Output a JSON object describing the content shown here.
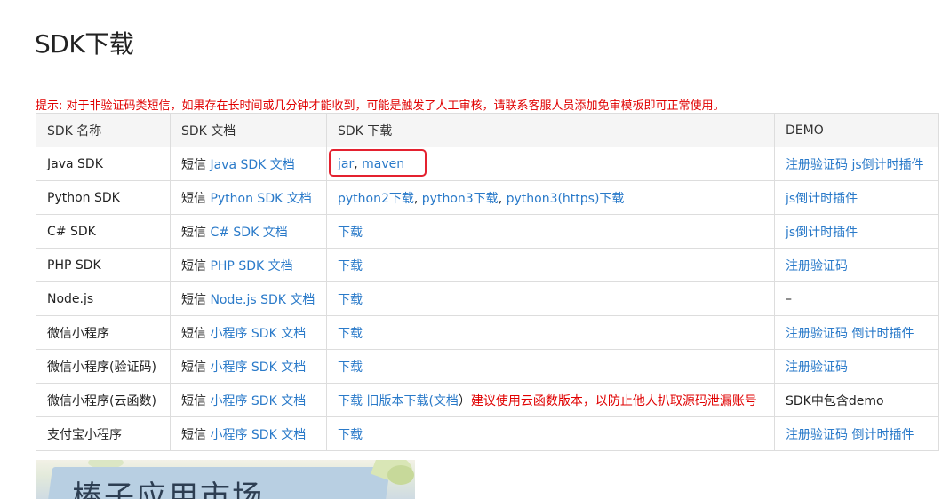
{
  "title": "SDK下载",
  "notice": "提示: 对于非验证码类短信，如果存在长时间或几分钟才能收到，可能是触发了人工审核，请联系客服人员添加免审模板即可正常使用。",
  "table": {
    "headers": [
      "SDK 名称",
      "SDK 文档",
      "SDK 下载",
      "DEMO"
    ],
    "rows": [
      {
        "name": "Java SDK",
        "doc_prefix": "短信",
        "doc_link": "Java SDK 文档",
        "downloads": [
          {
            "text": "jar"
          },
          {
            "sep": ", "
          },
          {
            "text": "maven"
          }
        ],
        "demo": [
          {
            "text": "注册验证码"
          },
          {
            "sep": " "
          },
          {
            "text": "js倒计时插件"
          }
        ]
      },
      {
        "name": "Python SDK",
        "doc_prefix": "短信",
        "doc_link": "Python SDK 文档",
        "downloads": [
          {
            "text": "python2下载"
          },
          {
            "sep": ", "
          },
          {
            "text": "python3下载"
          },
          {
            "sep": ", "
          },
          {
            "text": "python3(https)下载"
          }
        ],
        "demo": [
          {
            "text": "js倒计时插件"
          }
        ]
      },
      {
        "name": "C# SDK",
        "doc_prefix": "短信",
        "doc_link": "C# SDK 文档",
        "downloads": [
          {
            "text": "下载"
          }
        ],
        "demo": [
          {
            "text": "js倒计时插件"
          }
        ]
      },
      {
        "name": "PHP SDK",
        "doc_prefix": "短信",
        "doc_link": "PHP SDK 文档",
        "downloads": [
          {
            "text": "下载"
          }
        ],
        "demo": [
          {
            "text": "注册验证码"
          }
        ]
      },
      {
        "name": "Node.js",
        "doc_prefix": "短信",
        "doc_link": "Node.js SDK 文档",
        "downloads": [
          {
            "text": "下载"
          }
        ],
        "demo_plain": "–"
      },
      {
        "name": "微信小程序",
        "doc_prefix": "短信",
        "doc_link": "小程序 SDK 文档",
        "downloads": [
          {
            "text": "下载"
          }
        ],
        "demo": [
          {
            "text": "注册验证码"
          },
          {
            "sep": " "
          },
          {
            "text": "倒计时插件"
          }
        ]
      },
      {
        "name": "微信小程序(验证码)",
        "doc_prefix": "短信",
        "doc_link": "小程序 SDK 文档",
        "downloads": [
          {
            "text": "下载"
          }
        ],
        "demo": [
          {
            "text": "注册验证码"
          }
        ]
      },
      {
        "name": "微信小程序(云函数)",
        "doc_prefix": "短信",
        "doc_link": "小程序 SDK 文档",
        "downloads": [
          {
            "text": "下载"
          },
          {
            "sep": " "
          },
          {
            "text": "旧版本下载(文档"
          },
          {
            "sep": "）"
          },
          {
            "warn": "建议使用云函数版本，以防止他人扒取源码泄漏账号"
          }
        ],
        "demo_plain": "SDK中包含demo"
      },
      {
        "name": "支付宝小程序",
        "doc_prefix": "短信",
        "doc_link": "小程序 SDK 文档",
        "downloads": [
          {
            "text": "下载"
          }
        ],
        "demo": [
          {
            "text": "注册验证码"
          },
          {
            "sep": " "
          },
          {
            "text": "倒计时插件"
          }
        ]
      }
    ]
  },
  "banner": {
    "text": "棒子应用市场"
  },
  "colors": {
    "link": "#2a7ac9",
    "warning": "#e00000",
    "highlight": "#e4212f",
    "header_bg": "#f5f5f5",
    "border": "#dddddd"
  }
}
